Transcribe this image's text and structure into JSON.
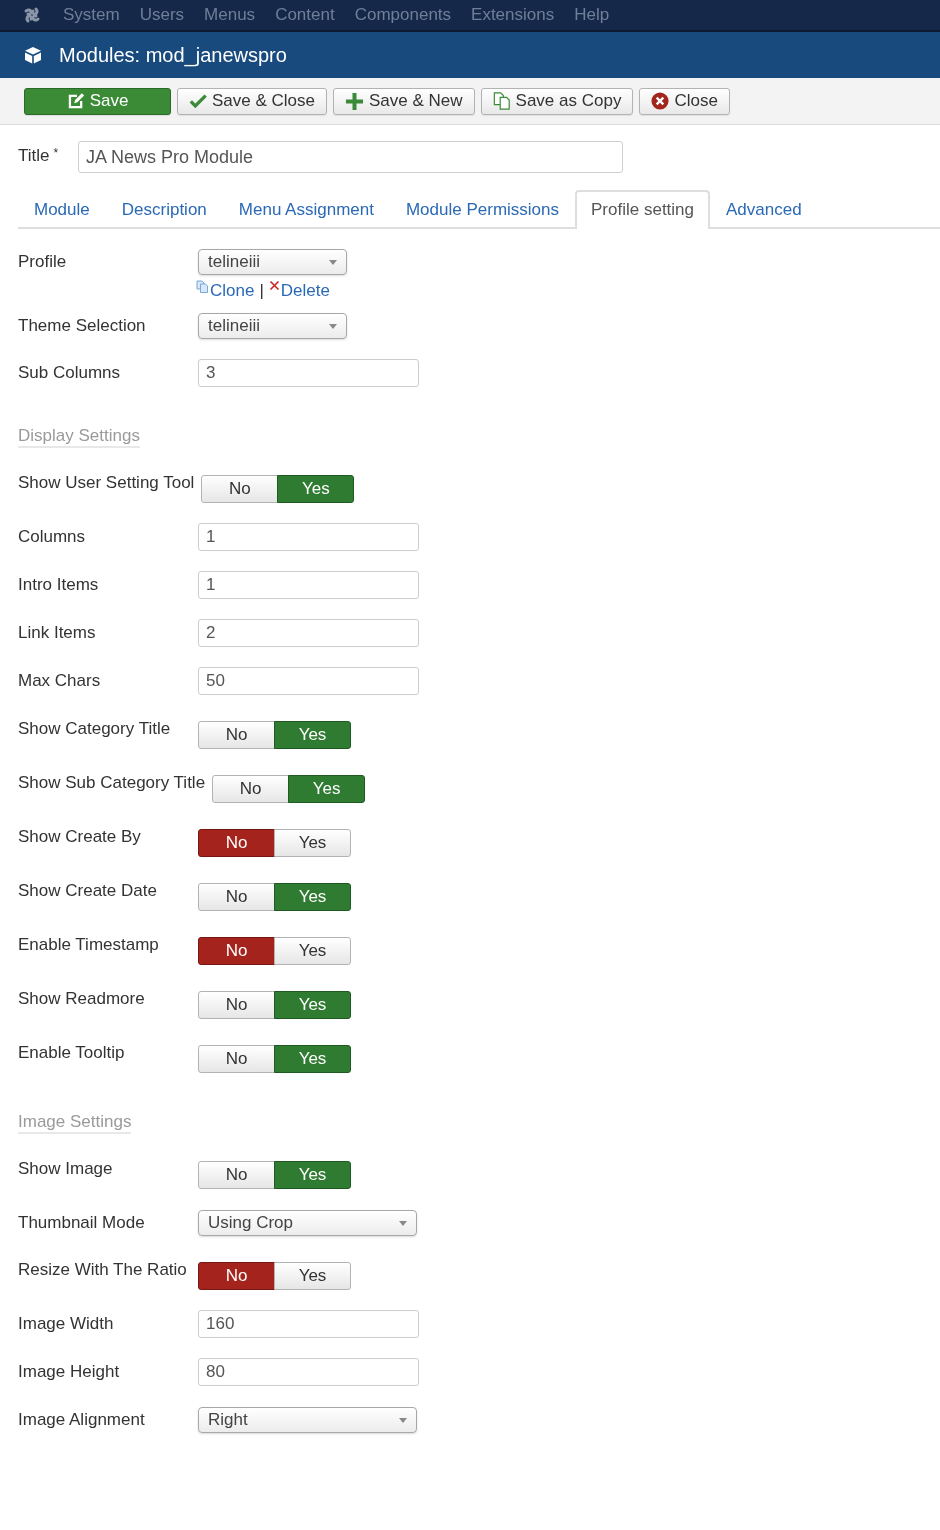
{
  "menubar": {
    "items": [
      "System",
      "Users",
      "Menus",
      "Content",
      "Components",
      "Extensions",
      "Help"
    ]
  },
  "header": {
    "title": "Modules: mod_janewspro"
  },
  "toolbar": {
    "buttons": [
      {
        "label": "Save",
        "kind": "apply"
      },
      {
        "label": "Save & Close",
        "kind": "save"
      },
      {
        "label": "Save & New",
        "kind": "new"
      },
      {
        "label": "Save as Copy",
        "kind": "copy"
      },
      {
        "label": "Close",
        "kind": "close"
      }
    ]
  },
  "title_field": {
    "label": "Title",
    "required_mark": "*",
    "value": "JA News Pro Module"
  },
  "tabs": [
    {
      "label": "Module",
      "selected": false
    },
    {
      "label": "Description",
      "selected": false
    },
    {
      "label": "Menu Assignment",
      "selected": false
    },
    {
      "label": "Module Permissions",
      "selected": false
    },
    {
      "label": "Profile setting",
      "selected": true
    },
    {
      "label": "Advanced",
      "selected": false
    }
  ],
  "sections": [
    {
      "fields": [
        {
          "label": "Profile",
          "kind": "profilelist",
          "value": "telineiii",
          "links": [
            {
              "label": "Clone",
              "kind": "clone"
            },
            {
              "label": "Delete",
              "kind": "delete"
            }
          ],
          "separator": "|"
        },
        {
          "label": "Theme Selection",
          "kind": "profilelist",
          "value": "telineiii"
        },
        {
          "label": "Sub Columns",
          "kind": "text",
          "value": "3"
        }
      ]
    },
    {
      "heading": "Display Settings",
      "fields": [
        {
          "label": "Show User Setting Tool",
          "kind": "toggle",
          "options": [
            {
              "label": "No",
              "selected": false
            },
            {
              "label": "Yes",
              "selected": true
            }
          ]
        },
        {
          "label": "Columns",
          "kind": "text",
          "value": "1"
        },
        {
          "label": "Intro Items",
          "kind": "text",
          "value": "1"
        },
        {
          "label": "Link Items",
          "kind": "text",
          "value": "2"
        },
        {
          "label": "Max Chars",
          "kind": "text",
          "value": "50"
        },
        {
          "label": "Show Category Title",
          "kind": "toggle",
          "options": [
            {
              "label": "No",
              "selected": false
            },
            {
              "label": "Yes",
              "selected": true
            }
          ]
        },
        {
          "label": "Show Sub Category Title",
          "kind": "toggle",
          "options": [
            {
              "label": "No",
              "selected": false
            },
            {
              "label": "Yes",
              "selected": true
            }
          ]
        },
        {
          "label": "Show Create By",
          "kind": "toggle",
          "options": [
            {
              "label": "No",
              "selected": true
            },
            {
              "label": "Yes",
              "selected": false
            }
          ]
        },
        {
          "label": "Show Create Date",
          "kind": "toggle",
          "options": [
            {
              "label": "No",
              "selected": false
            },
            {
              "label": "Yes",
              "selected": true
            }
          ]
        },
        {
          "label": "Enable Timestamp",
          "kind": "toggle",
          "options": [
            {
              "label": "No",
              "selected": true
            },
            {
              "label": "Yes",
              "selected": false
            }
          ]
        },
        {
          "label": "Show Readmore",
          "kind": "toggle",
          "options": [
            {
              "label": "No",
              "selected": false
            },
            {
              "label": "Yes",
              "selected": true
            }
          ]
        },
        {
          "label": "Enable Tooltip",
          "kind": "toggle",
          "options": [
            {
              "label": "No",
              "selected": false
            },
            {
              "label": "Yes",
              "selected": true
            }
          ]
        }
      ]
    },
    {
      "heading": "Image Settings",
      "fields": [
        {
          "label": "Show Image",
          "kind": "toggle",
          "options": [
            {
              "label": "No",
              "selected": false
            },
            {
              "label": "Yes",
              "selected": true
            }
          ]
        },
        {
          "label": "Thumbnail Mode",
          "kind": "select",
          "value": "Using Crop"
        },
        {
          "label": "Resize With The Ratio",
          "kind": "toggle",
          "options": [
            {
              "label": "No",
              "selected": true
            },
            {
              "label": "Yes",
              "selected": false
            }
          ]
        },
        {
          "label": "Image Width",
          "kind": "text",
          "value": "160"
        },
        {
          "label": "Image Height",
          "kind": "text",
          "value": "80"
        },
        {
          "label": "Image Alignment",
          "kind": "select",
          "value": "Right"
        }
      ]
    }
  ]
}
